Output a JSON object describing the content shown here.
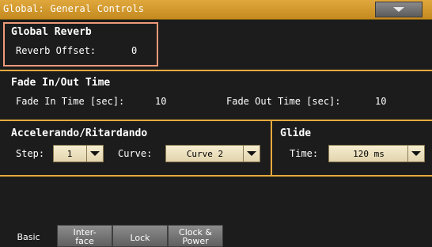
{
  "header": {
    "title": "Global: General Controls",
    "menu_icon": "chevron-down-icon"
  },
  "global_reverb": {
    "heading": "Global Reverb",
    "offset_label": "Reverb Offset:",
    "offset_value": "0"
  },
  "fade": {
    "heading": "Fade In/Out Time",
    "in_label": "Fade In Time [sec]:",
    "in_value": "10",
    "out_label": "Fade Out Time [sec]:",
    "out_value": "10"
  },
  "accel": {
    "heading": "Accelerando/Ritardando",
    "step_label": "Step:",
    "step_value": "1",
    "curve_label": "Curve:",
    "curve_value": "Curve 2"
  },
  "glide": {
    "heading": "Glide",
    "time_label": "Time:",
    "time_value": "120 ms"
  },
  "tabs": [
    {
      "line1": "Basic",
      "line2": ""
    },
    {
      "line1": "Inter-",
      "line2": "face"
    },
    {
      "line1": "Lock",
      "line2": ""
    },
    {
      "line1": "Clock &",
      "line2": "Power"
    }
  ],
  "colors": {
    "accent": "#e6a93d",
    "highlight": "#f0997a",
    "background": "#1c1c1c"
  }
}
